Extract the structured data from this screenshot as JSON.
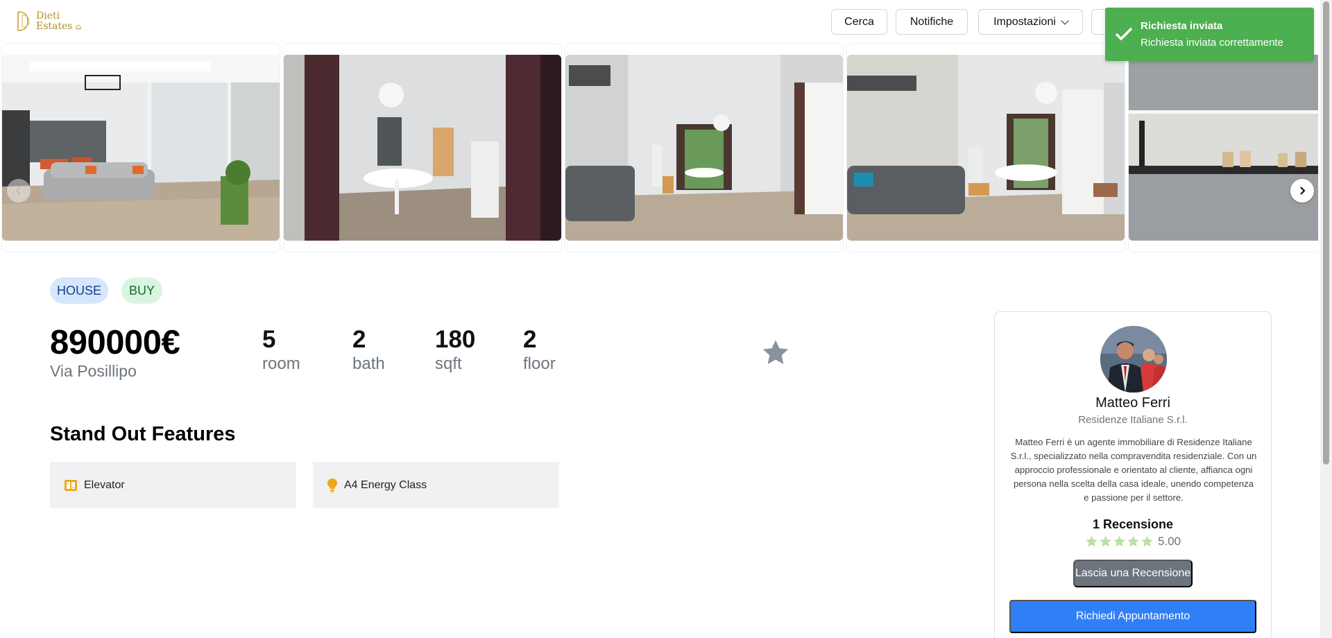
{
  "brand": {
    "logo_text_line1": "Dieti",
    "logo_text_line2": "Estates"
  },
  "navbar": {
    "search_label": "Cerca",
    "notifications_label": "Notifiche",
    "settings_label": "Impostazioni"
  },
  "toast": {
    "title": "Richiesta inviata",
    "message": "Richiesta inviata correttamente",
    "color": "#4caf50"
  },
  "gallery": {
    "photos": [
      "living-room-with-kitchen",
      "hallway-to-dining-room",
      "dining-room-with-window",
      "living-room-with-sofa",
      "kitchen-counter"
    ]
  },
  "listing": {
    "tags": [
      "HOUSE",
      "BUY"
    ],
    "price": "890000€",
    "address": "Via Posillipo",
    "stats": [
      {
        "value": "5",
        "label": "room"
      },
      {
        "value": "2",
        "label": "bath"
      },
      {
        "value": "180",
        "label": "sqft"
      },
      {
        "value": "2",
        "label": "floor"
      }
    ],
    "features_title": "Stand Out Features",
    "features": [
      {
        "icon": "elevator-icon",
        "label": "Elevator"
      },
      {
        "icon": "lightbulb-icon",
        "label": "A4 Energy Class"
      }
    ]
  },
  "agent": {
    "name": "Matteo Ferri",
    "company": "Residenze Italiane S.r.l.",
    "bio": "Matteo Ferri è un agente immobiliare di Residenze Italiane S.r.l., specializzato nella compravendita residenziale. Con un approccio professionale e orientato al cliente, affianca ogni persona nella scelta della casa ideale, unendo competenza e passione per il settore.",
    "reviews_count": "1 Recensione",
    "rating": 5,
    "rating_label": "5.00",
    "review_button": "Lascia una Recensione",
    "appointment_button": "Richiedi Appuntamento"
  },
  "colors": {
    "accent_blue": "#2f7ff7",
    "secondary_gray": "#6c757d",
    "brand_gold": "#b58f21",
    "star_gray": "#8a929c",
    "rating_green": "#b9e0a5"
  }
}
